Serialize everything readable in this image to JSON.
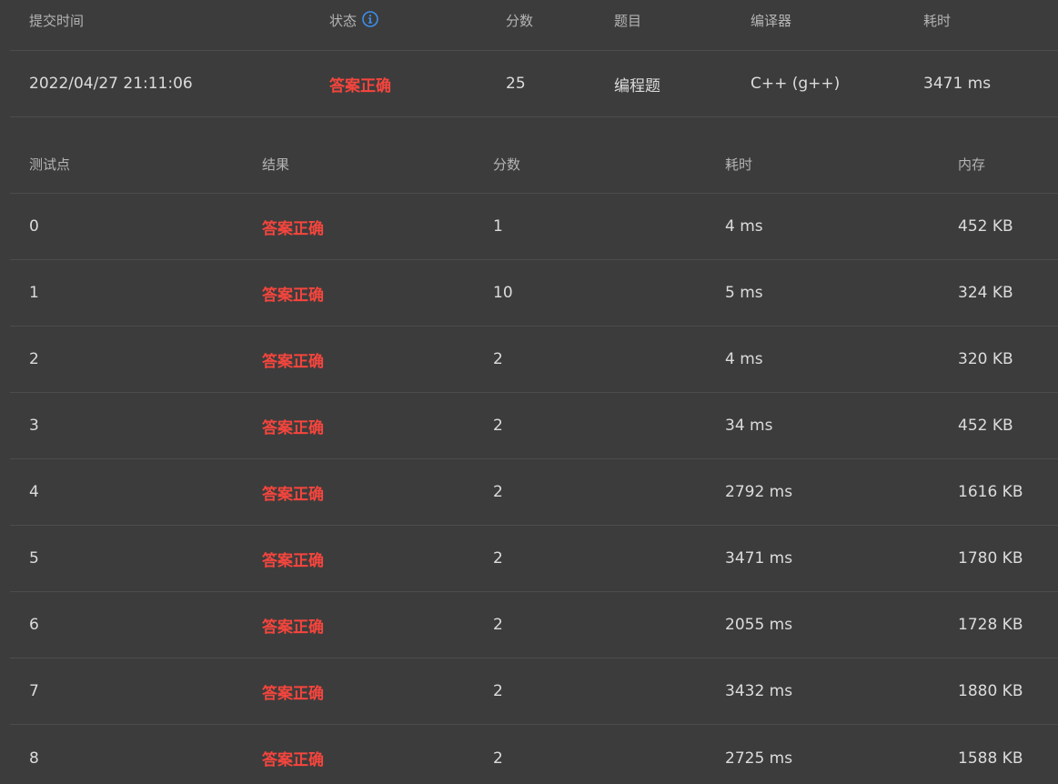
{
  "summary": {
    "headers": {
      "submit_time": "提交时间",
      "status": "状态",
      "score": "分数",
      "problem": "题目",
      "compiler": "编译器",
      "time": "耗时"
    },
    "row": {
      "submit_time": "2022/04/27 21:11:06",
      "status": "答案正确",
      "score": "25",
      "problem": "编程题",
      "compiler": "C++ (g++)",
      "time": "3471 ms"
    }
  },
  "tests": {
    "headers": {
      "case": "测试点",
      "result": "结果",
      "score": "分数",
      "time": "耗时",
      "memory": "内存"
    },
    "rows": [
      {
        "case": "0",
        "result": "答案正确",
        "score": "1",
        "time": "4 ms",
        "memory": "452 KB"
      },
      {
        "case": "1",
        "result": "答案正确",
        "score": "10",
        "time": "5 ms",
        "memory": "324 KB"
      },
      {
        "case": "2",
        "result": "答案正确",
        "score": "2",
        "time": "4 ms",
        "memory": "320 KB"
      },
      {
        "case": "3",
        "result": "答案正确",
        "score": "2",
        "time": "34 ms",
        "memory": "452 KB"
      },
      {
        "case": "4",
        "result": "答案正确",
        "score": "2",
        "time": "2792 ms",
        "memory": "1616 KB"
      },
      {
        "case": "5",
        "result": "答案正确",
        "score": "2",
        "time": "3471 ms",
        "memory": "1780 KB"
      },
      {
        "case": "6",
        "result": "答案正确",
        "score": "2",
        "time": "2055 ms",
        "memory": "1728 KB"
      },
      {
        "case": "7",
        "result": "答案正确",
        "score": "2",
        "time": "3432 ms",
        "memory": "1880 KB"
      },
      {
        "case": "8",
        "result": "答案正确",
        "score": "2",
        "time": "2725 ms",
        "memory": "1588 KB"
      }
    ]
  },
  "colors": {
    "background": "#3c3c3c",
    "accepted": "#f5453d",
    "info_icon": "#3b8ff0"
  },
  "icons": {
    "status_info": "info-circle-icon"
  }
}
